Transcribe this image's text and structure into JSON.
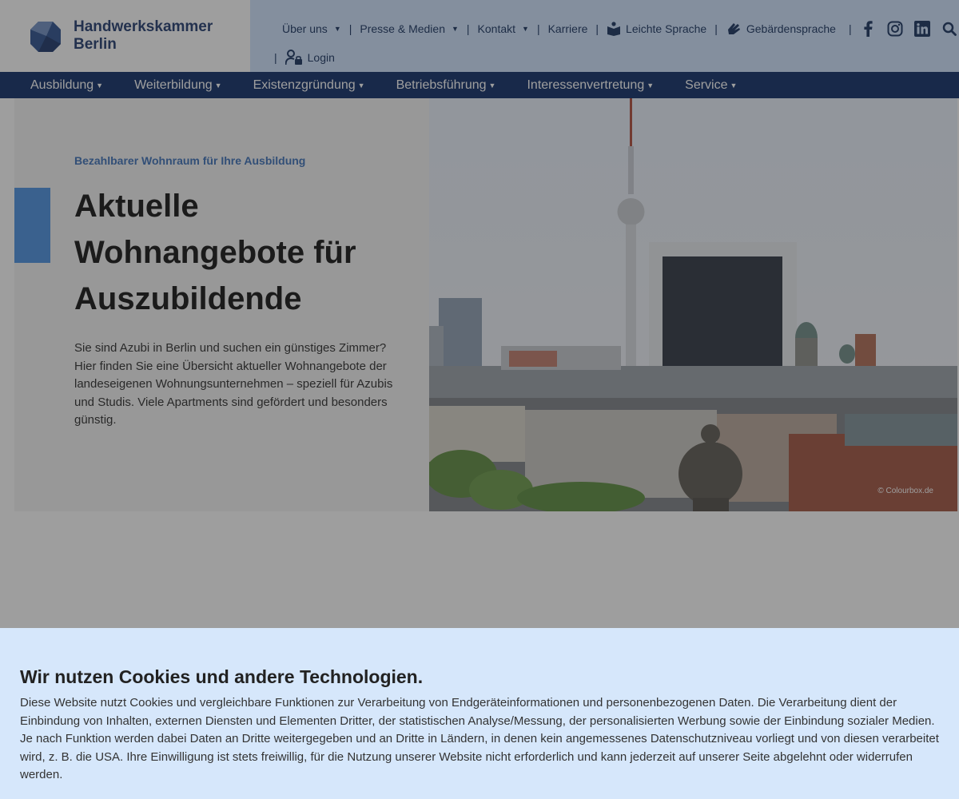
{
  "brand": {
    "line1": "Handwerkskammer",
    "line2": "Berlin",
    "color": "#1f3a6e"
  },
  "meta_nav": {
    "items": [
      {
        "label": "Über uns",
        "dropdown": true
      },
      {
        "label": "Presse & Medien",
        "dropdown": true
      },
      {
        "label": "Kontakt",
        "dropdown": true
      },
      {
        "label": "Karriere",
        "dropdown": false
      },
      {
        "label": "Leichte Sprache",
        "icon": "book-reader-icon"
      },
      {
        "label": "Gebärdensprache",
        "icon": "sign-language-icon"
      }
    ],
    "social": [
      "facebook-icon",
      "instagram-icon",
      "linkedin-icon",
      "search-icon"
    ],
    "login_label": "Login"
  },
  "main_nav": {
    "items": [
      "Ausbildung",
      "Weiterbildung",
      "Existenzgründung",
      "Betriebsführung",
      "Interessenvertretung",
      "Service"
    ]
  },
  "hero": {
    "kicker": "Bezahlbarer Wohnraum für Ihre Ausbildung",
    "title": "Aktuelle Wohnangebote für Auszubildende",
    "text": "Sie sind Azubi in Berlin und suchen ein günstiges Zimmer? Hier finden Sie eine Übersicht aktueller Wohnangebote der landeseigenen Wohnungsunternehmen – speziell für Azubis und Studis. Viele Apartments sind gefördert und besonders günstig.",
    "image_credit": "© Colourbox.de",
    "accent_color": "#4a90e2"
  },
  "cookie_banner": {
    "title": "Wir nutzen Cookies und andere Technologien.",
    "text": "Diese Website nutzt Cookies und vergleichbare Funktionen zur Verarbeitung von Endgeräteinformationen und personenbezogenen Daten. Die Verarbeitung dient der Einbindung von Inhalten, externen Diensten und Elementen Dritter, der statistischen Analyse/Messung, der personalisierten Werbung sowie der Einbindung sozialer Medien. Je nach Funktion werden dabei Daten an Dritte weitergegeben und an Dritte in Ländern, in denen kein angemessenes Datenschutzniveau vorliegt und von diesen verarbeitet wird, z. B. die USA. Ihre Einwilligung ist stets freiwillig, für die Nutzung unserer Website nicht erforderlich und kann jederzeit auf unserer Seite abgelehnt oder widerrufen werden.",
    "background": "#d6e7fb"
  }
}
